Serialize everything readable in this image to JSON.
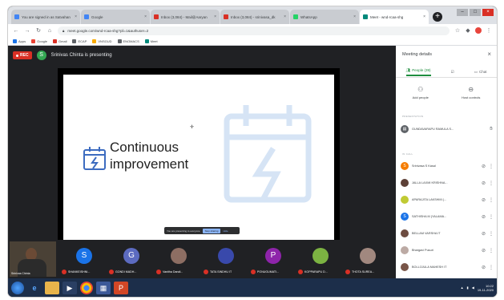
{
  "browser": {
    "tabs": [
      {
        "label": "You are signed in as Satvahan",
        "color": "#4285f4",
        "active": false
      },
      {
        "label": "Google",
        "color": "#4285f4",
        "active": false
      },
      {
        "label": "Inbox (3,084) - Mail@Aaryan",
        "color": "#d93025",
        "active": false
      },
      {
        "label": "Inbox (3,084) - srinivasa_dk",
        "color": "#d93025",
        "active": false
      },
      {
        "label": "WhatsApp",
        "color": "#25d366",
        "active": false
      },
      {
        "label": "Meet - wnd-rcaa-shg",
        "color": "#00897b",
        "active": true
      }
    ],
    "url": "meet.google.com/wnd-rcaa-shg?pli=1&authuser=2",
    "bookmarks": [
      "Apps",
      "Google",
      "Gmail",
      "ECAP",
      "VNSGUD",
      "ENOMACS",
      "Meet"
    ]
  },
  "meeting": {
    "rec_label": "REC",
    "presenter_initial": "S",
    "presenting_text": "Srinivas Chinta is presenting",
    "slide_title": "Continuous improvement",
    "share_bar": {
      "text": "You are presenting to everyone",
      "stop_label": "Stop sharing",
      "hide_label": "Hide"
    }
  },
  "self": {
    "name": "Srinivas Chinta"
  },
  "participants": [
    {
      "initial": "S",
      "name": "SHANKEISHNI...",
      "color": "#1a73e8",
      "photo": false
    },
    {
      "initial": "G",
      "name": "GONDI MADH...",
      "color": "#5c6bc0",
      "photo": false
    },
    {
      "initial": "",
      "name": "Vanitha Dandi...",
      "color": "#8d6e63",
      "photo": true
    },
    {
      "initial": "",
      "name": "TATA SINDHU IT",
      "color": "#3949ab",
      "photo": true
    },
    {
      "initial": "P",
      "name": "PONUGUMATI...",
      "color": "#8e24aa",
      "photo": false
    },
    {
      "initial": "",
      "name": "KOPPARAPU D...",
      "color": "#7cb342",
      "photo": true
    },
    {
      "initial": "",
      "name": "THOTA SUREA...",
      "color": "#a1887f",
      "photo": true
    }
  ],
  "panel": {
    "title": "Meeting details",
    "tabs": [
      {
        "label": "People (39)",
        "active": true
      },
      {
        "label": "",
        "active": false
      },
      {
        "label": "Chat",
        "active": false
      }
    ],
    "actions": [
      "Add people",
      "Host controls"
    ],
    "section_presenting": "PRESENTATION",
    "presenting_row": "GUNDAVARAPU RAMULA S...",
    "section_people": "IN CALL",
    "people": [
      {
        "initial": "S",
        "name": "Srinivasa S Kasal",
        "color": "#f57c00"
      },
      {
        "initial": "",
        "name": "JALLA LAXMI KRISHNA...",
        "color": "#5d4037"
      },
      {
        "initial": "",
        "name": "APARAJITA LAKSHMI (...",
        "color": "#c0ca33"
      },
      {
        "initial": "S",
        "name": "SATHISHA M (YALAMA...",
        "color": "#1a73e8"
      },
      {
        "initial": "",
        "name": "BELLAM VARSHA IT",
        "color": "#6d4c41"
      },
      {
        "initial": "",
        "name": "Bhargavi Pusuri",
        "color": "#bcaaa4"
      },
      {
        "initial": "",
        "name": "BOLLOJULA MAHESH IT",
        "color": "#795548"
      }
    ]
  },
  "taskbar": {
    "time": "10:22",
    "date": "19-11-2020"
  }
}
